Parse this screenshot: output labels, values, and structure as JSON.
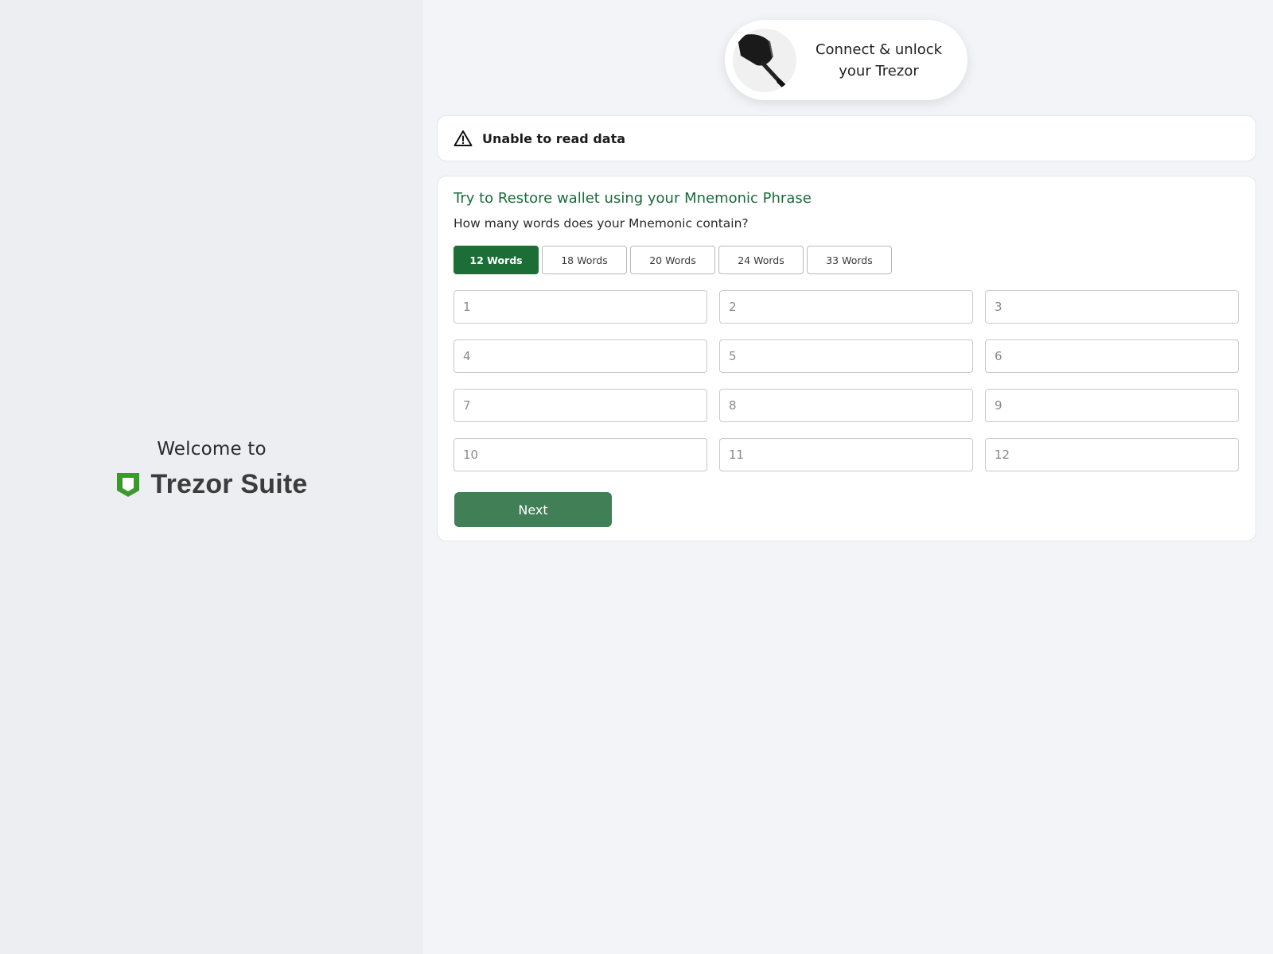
{
  "left_panel": {
    "welcome": "Welcome to",
    "brand": "Trezor Suite"
  },
  "device_pill": {
    "line1": "Connect & unlock",
    "line2": "your Trezor"
  },
  "alert": {
    "icon": "warning-triangle-icon",
    "text": "Unable to read data"
  },
  "restore": {
    "title": "Try to Restore wallet using your Mnemonic Phrase",
    "question": "How many words does your Mnemonic contain?",
    "tabs": [
      {
        "label": "12 Words",
        "active": true
      },
      {
        "label": "18 Words",
        "active": false
      },
      {
        "label": "20 Words",
        "active": false
      },
      {
        "label": "24 Words",
        "active": false
      },
      {
        "label": "33 Words",
        "active": false
      }
    ],
    "word_fields": [
      {
        "placeholder": "1",
        "value": ""
      },
      {
        "placeholder": "2",
        "value": ""
      },
      {
        "placeholder": "3",
        "value": ""
      },
      {
        "placeholder": "4",
        "value": ""
      },
      {
        "placeholder": "5",
        "value": ""
      },
      {
        "placeholder": "6",
        "value": ""
      },
      {
        "placeholder": "7",
        "value": ""
      },
      {
        "placeholder": "8",
        "value": ""
      },
      {
        "placeholder": "9",
        "value": ""
      },
      {
        "placeholder": "10",
        "value": ""
      },
      {
        "placeholder": "11",
        "value": ""
      },
      {
        "placeholder": "12",
        "value": ""
      }
    ],
    "next_label": "Next"
  },
  "colors": {
    "accent_green": "#1b6f36",
    "title_green": "#1a6b3c",
    "button_green": "#417f56",
    "logo_green": "#3a9a2b"
  }
}
